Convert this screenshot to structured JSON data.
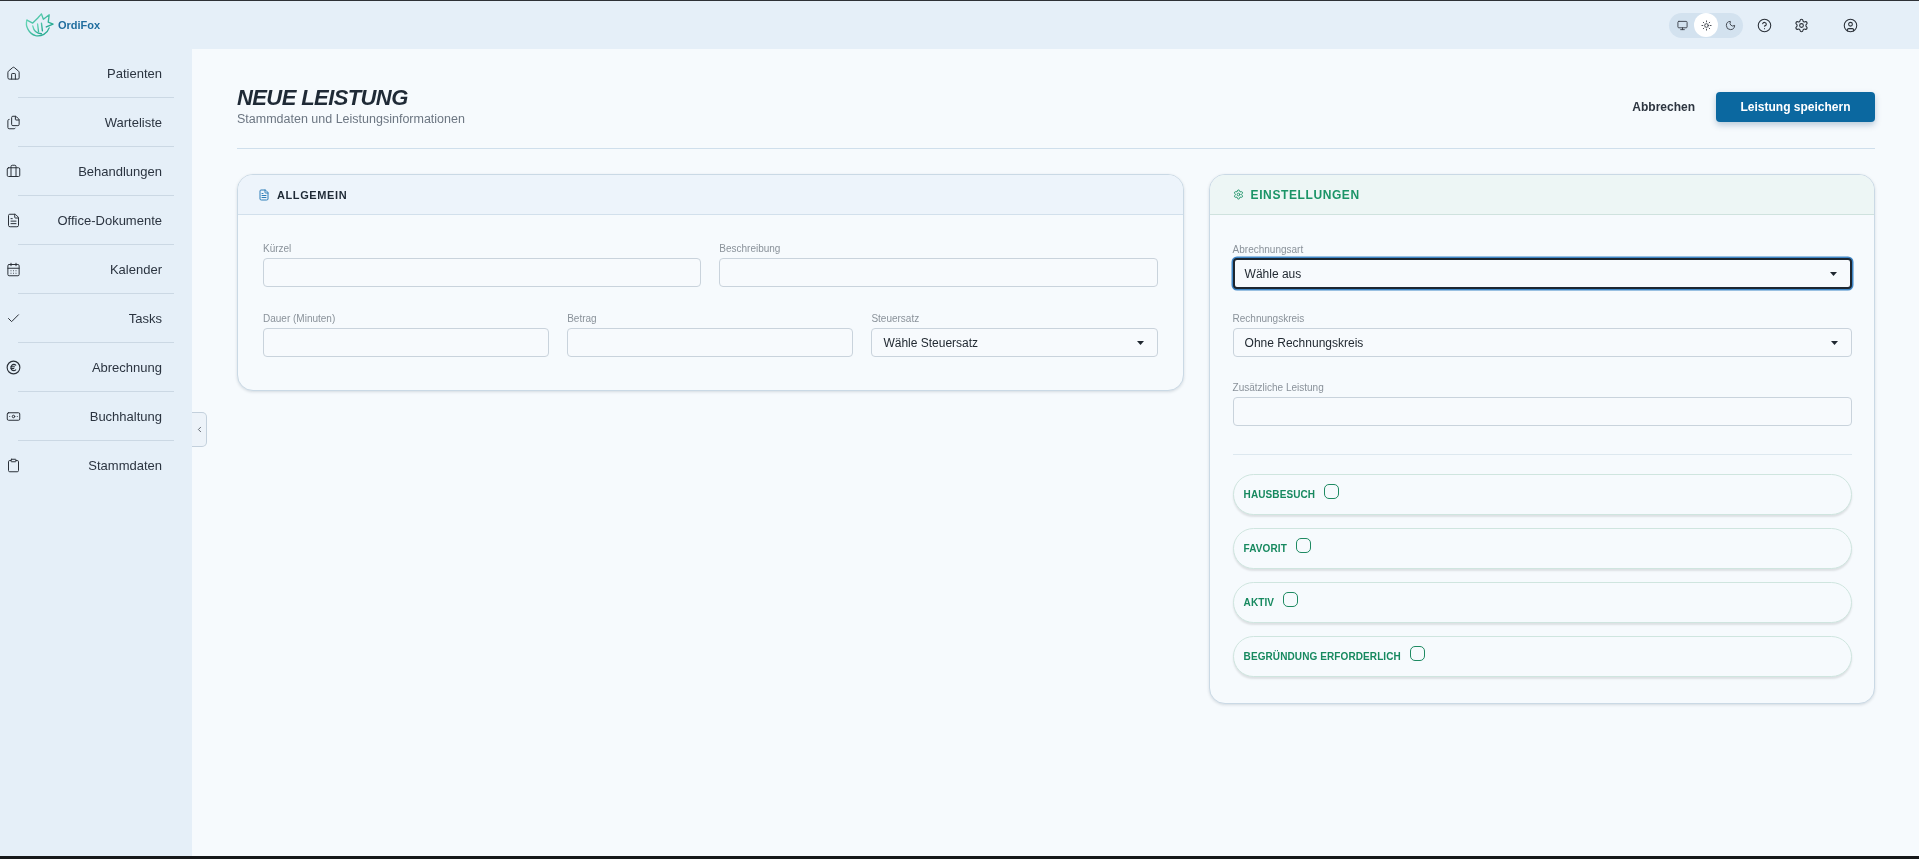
{
  "app": {
    "name": "OrdiFox"
  },
  "header": {
    "theme_options": [
      {
        "selected": false
      },
      {
        "selected": true
      },
      {
        "selected": false
      }
    ]
  },
  "sidebar": {
    "items": [
      {
        "label": "Patienten"
      },
      {
        "label": "Warteliste"
      },
      {
        "label": "Behandlungen"
      },
      {
        "label": "Office-Dokumente"
      },
      {
        "label": "Kalender"
      },
      {
        "label": "Tasks"
      },
      {
        "label": "Abrechnung"
      },
      {
        "label": "Buchhaltung"
      },
      {
        "label": "Stammdaten"
      }
    ]
  },
  "page": {
    "title": "NEUE LEISTUNG",
    "subtitle": "Stammdaten und Leistungsinformationen",
    "actions": [
      {
        "label": "Abbrechen",
        "kind": "secondary"
      },
      {
        "label": "Leistung speichern",
        "kind": "primary"
      }
    ]
  },
  "general": {
    "title": "ALLGEMEIN",
    "rows": [
      {
        "fields": [
          {
            "label": "Kürzel",
            "kind": "input",
            "focused": false
          },
          {
            "label": "Beschreibung",
            "kind": "input",
            "focused": false
          }
        ]
      },
      {
        "fields": [
          {
            "label": "Dauer (Minuten)",
            "kind": "input",
            "focused": false
          },
          {
            "label": "Betrag",
            "kind": "input",
            "focused": false
          },
          {
            "label": "Steuersatz",
            "kind": "select",
            "value": "Wähle Steuersatz",
            "focused": false
          }
        ]
      }
    ]
  },
  "settings": {
    "title": "EINSTELLUNGEN",
    "fields": [
      {
        "label": "Abrechnungsart",
        "kind": "select",
        "value": "Wähle aus",
        "focused": true
      },
      {
        "label": "Rechnungskreis",
        "kind": "select",
        "value": "Ohne Rechnungskreis",
        "focused": false
      },
      {
        "label": "Zusätzliche Leistung",
        "kind": "input",
        "focused": false
      }
    ],
    "toggles": [
      {
        "label": "HAUSBESUCH",
        "checked": false
      },
      {
        "label": "FAVORIT",
        "checked": false
      },
      {
        "label": "AKTIV",
        "checked": false
      },
      {
        "label": "BEGRÜNDUNG ERFORDERLICH",
        "checked": false
      }
    ]
  }
}
